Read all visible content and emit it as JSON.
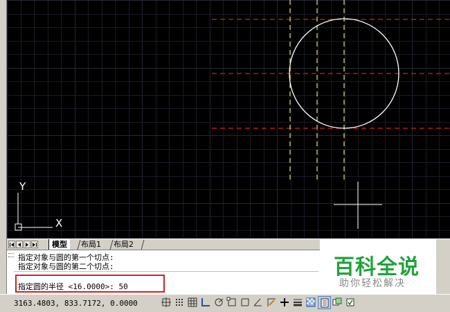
{
  "tabs": [
    {
      "label": "模型",
      "active": true
    },
    {
      "label": "布局1",
      "active": false
    },
    {
      "label": "布局2",
      "active": false
    }
  ],
  "command_history": [
    "指定对象与圆的第一个切点:",
    "指定对象与圆的第二个切点:"
  ],
  "command_prompt": "指定圆的半径 <16.0000>: 50",
  "coordinates": "3163.4803, 833.7172, 0.0000",
  "ucs": {
    "x_label": "X",
    "y_label": "Y"
  },
  "watermark": {
    "title": "百科全说",
    "subtitle": "助你轻松解决"
  },
  "status_buttons": [
    {
      "name": "snap-mode-icon",
      "on": false
    },
    {
      "name": "grid-display-icon",
      "on": false
    },
    {
      "name": "grid-mode-icon",
      "on": false
    },
    {
      "name": "ortho-mode-icon",
      "on": false
    },
    {
      "name": "polar-tracking-icon",
      "on": false
    },
    {
      "name": "object-snap-icon",
      "on": false
    },
    {
      "name": "3d-object-snap-icon",
      "on": false
    },
    {
      "name": "object-snap-tracking-icon",
      "on": false
    },
    {
      "name": "dynamic-ucs-icon",
      "on": false
    },
    {
      "name": "dynamic-input-icon",
      "on": false
    },
    {
      "name": "lineweight-icon",
      "on": false
    },
    {
      "name": "transparency-icon",
      "on": false
    },
    {
      "name": "quick-properties-icon",
      "on": true
    },
    {
      "name": "selection-cycling-icon",
      "on": false
    },
    {
      "name": "annotation-monitor-icon",
      "on": false
    }
  ],
  "colors": {
    "canvas": "#000000",
    "grid": "#1a1a26",
    "grid_major": "#262633",
    "circle": "#ffffff",
    "red_dashed": "#d42020",
    "yellow_dashed": "#e8e07a",
    "highlight_box": "#d42020",
    "watermark_green": "#1fa33a"
  }
}
